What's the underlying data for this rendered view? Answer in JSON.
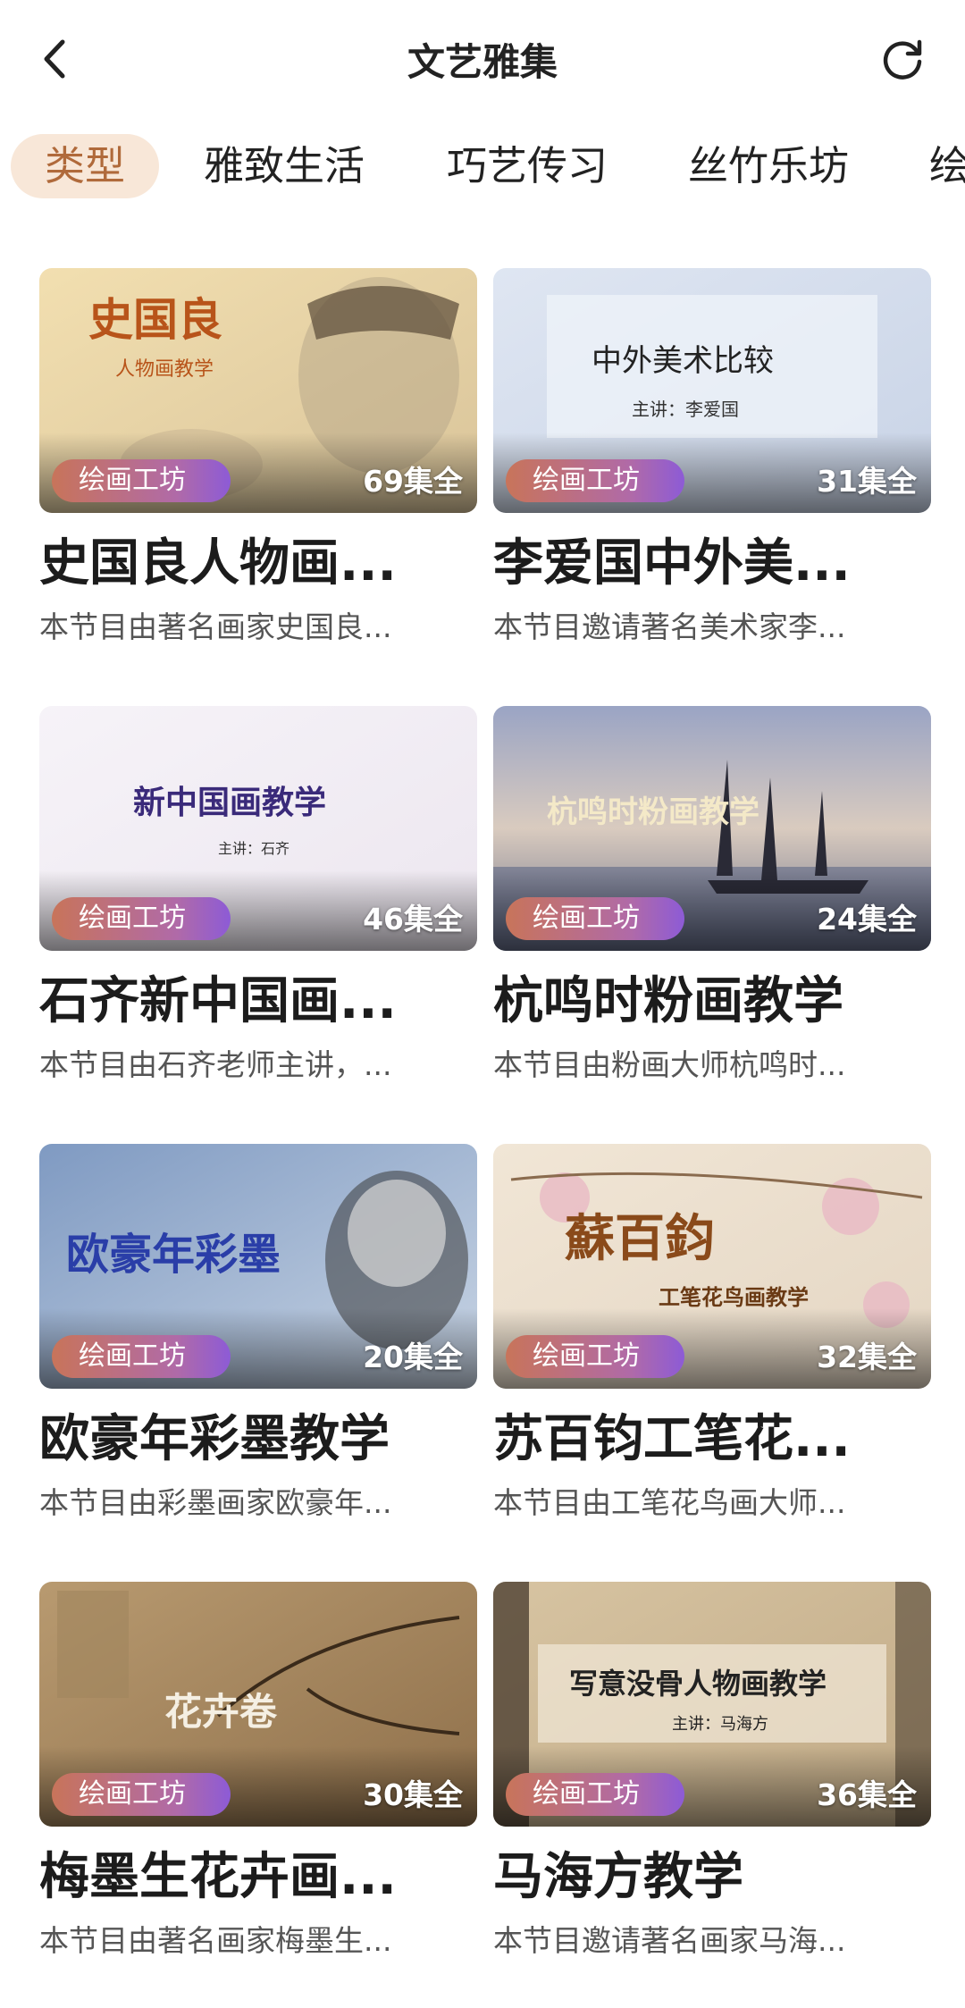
{
  "header": {
    "title": "文艺雅集",
    "back_icon": "chevron-left-icon",
    "refresh_icon": "refresh-icon"
  },
  "tabs": [
    {
      "label": "类型",
      "active": true
    },
    {
      "label": "雅致生活",
      "active": false
    },
    {
      "label": "巧艺传习",
      "active": false
    },
    {
      "label": "丝竹乐坊",
      "active": false
    },
    {
      "label": "绘",
      "active": false
    }
  ],
  "colors": {
    "accent_tab_bg": "#f8e7d8",
    "accent_tab_text": "#b06a3b",
    "badge_gradient_start": "#c8745a",
    "badge_gradient_end": "#8d5bd6"
  },
  "cards": [
    {
      "badge": "绘画工坊",
      "count": "69集全",
      "title": "史国良人物画...",
      "desc": "本节目由著名画家史国良...",
      "thumb_text": "史国良",
      "thumb_sub": "人物画教学"
    },
    {
      "badge": "绘画工坊",
      "count": "31集全",
      "title": "李爱国中外美...",
      "desc": "本节目邀请著名美术家李...",
      "thumb_text": "中外美术比较",
      "thumb_sub": "主讲：李爱国"
    },
    {
      "badge": "绘画工坊",
      "count": "46集全",
      "title": "石齐新中国画...",
      "desc": "本节目由石齐老师主讲，...",
      "thumb_text": "新中国画教学",
      "thumb_sub": "主讲：石齐"
    },
    {
      "badge": "绘画工坊",
      "count": "24集全",
      "title": "杭鸣时粉画教学",
      "desc": "本节目由粉画大师杭鸣时...",
      "thumb_text": "杭鸣时粉画教学",
      "thumb_sub": ""
    },
    {
      "badge": "绘画工坊",
      "count": "20集全",
      "title": "欧豪年彩墨教学",
      "desc": "本节目由彩墨画家欧豪年...",
      "thumb_text": "欧豪年彩墨",
      "thumb_sub": ""
    },
    {
      "badge": "绘画工坊",
      "count": "32集全",
      "title": "苏百钧工笔花...",
      "desc": "本节目由工笔花鸟画大师...",
      "thumb_text": "蘇百鈞",
      "thumb_sub": "工笔花鸟画教学"
    },
    {
      "badge": "绘画工坊",
      "count": "30集全",
      "title": "梅墨生花卉画...",
      "desc": "本节目由著名画家梅墨生...",
      "thumb_text": "花卉卷",
      "thumb_sub": ""
    },
    {
      "badge": "绘画工坊",
      "count": "36集全",
      "title": "马海方教学",
      "desc": "本节目邀请著名画家马海...",
      "thumb_text": "写意没骨人物画教学",
      "thumb_sub": "主讲：马海方"
    }
  ]
}
